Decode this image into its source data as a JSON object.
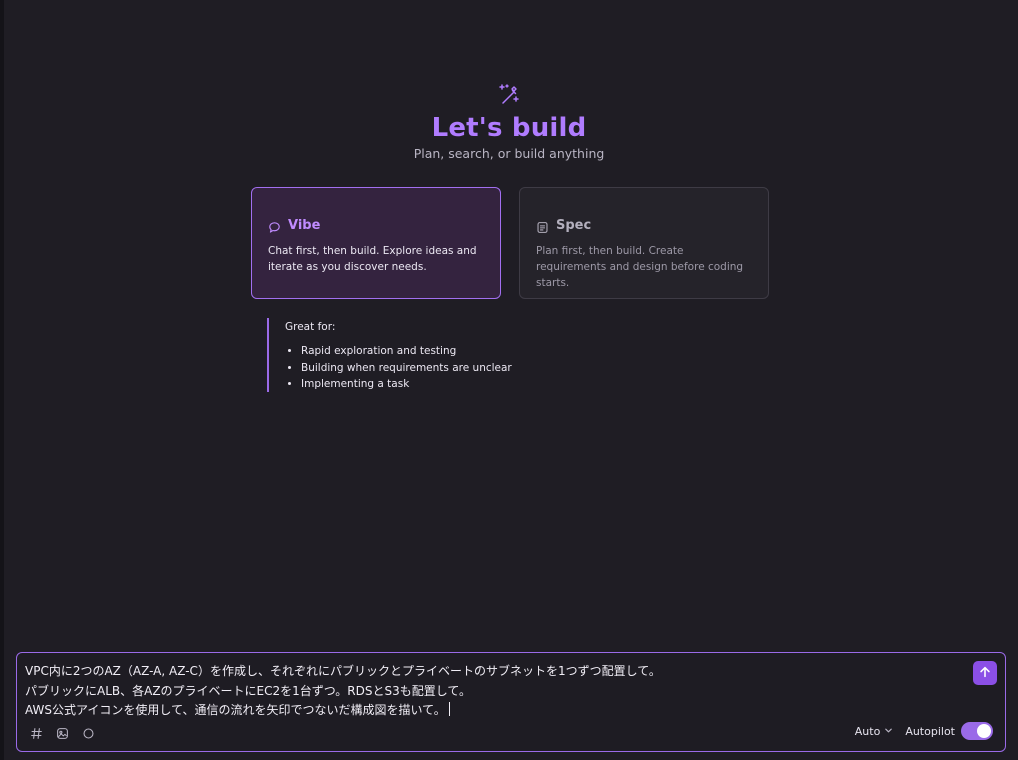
{
  "hero": {
    "title": "Let's build",
    "subtitle": "Plan, search, or build anything"
  },
  "modes": {
    "vibe": {
      "title": "Vibe",
      "description": "Chat first, then build. Explore ideas and iterate as you discover needs.",
      "selected": true
    },
    "spec": {
      "title": "Spec",
      "description": "Plan first, then build. Create requirements and design before coding starts.",
      "selected": false
    }
  },
  "great_for": {
    "title": "Great for:",
    "items": [
      "Rapid exploration and testing",
      "Building when requirements are unclear",
      "Implementing a task"
    ]
  },
  "composer": {
    "lines": [
      "VPC内に2つのAZ（AZ-A, AZ-C）を作成し、それぞれにパブリックとプライベートのサブネットを1つずつ配置して。",
      "パブリックにALB、各AZのプライベートにEC2を1台ずつ。RDSとS3も配置して。",
      "AWS公式アイコンを使用して、通信の流れを矢印でつないだ構成図を描いて。"
    ],
    "model": "Auto",
    "autopilot_label": "Autopilot",
    "autopilot_on": true
  },
  "colors": {
    "accent": "#b07cff",
    "accent_border": "#9a6ae8",
    "background": "#1f1d24",
    "send_button": "#8b4fe6"
  },
  "icons": {
    "hero": "magic-wand-icon",
    "vibe": "chat-bubble-icon",
    "spec": "document-icon",
    "send": "arrow-up-icon",
    "context": "hash-icon",
    "image": "image-icon",
    "circle": "circle-icon",
    "dropdown": "chevron-down-icon"
  }
}
